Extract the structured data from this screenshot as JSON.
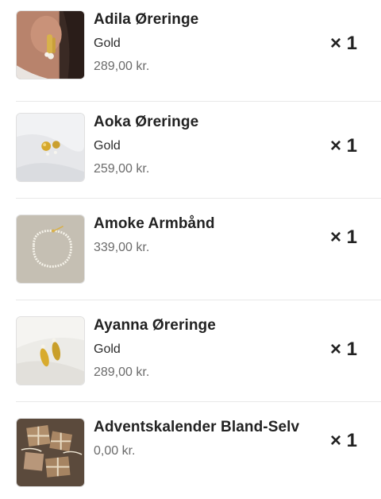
{
  "cart": {
    "items": [
      {
        "name": "Adila Øreringe",
        "variant": "Gold",
        "price": "289,00 kr.",
        "quantity": "× 1",
        "image_icon": "gold-hoop-earring-photo"
      },
      {
        "name": "Aoka Øreringe",
        "variant": "Gold",
        "price": "259,00 kr.",
        "quantity": "× 1",
        "image_icon": "gold-stud-earrings-photo"
      },
      {
        "name": "Amoke Armbånd",
        "price": "339,00 kr.",
        "quantity": "× 1",
        "image_icon": "pearl-bracelet-photo"
      },
      {
        "name": "Ayanna Øreringe",
        "variant": "Gold",
        "price": "289,00 kr.",
        "quantity": "× 1",
        "image_icon": "gold-leaf-earrings-photo"
      },
      {
        "name": "Adventskalender Bland-Selv",
        "price": "0,00 kr.",
        "quantity": "× 1",
        "image_icon": "gift-boxes-photo"
      }
    ]
  }
}
